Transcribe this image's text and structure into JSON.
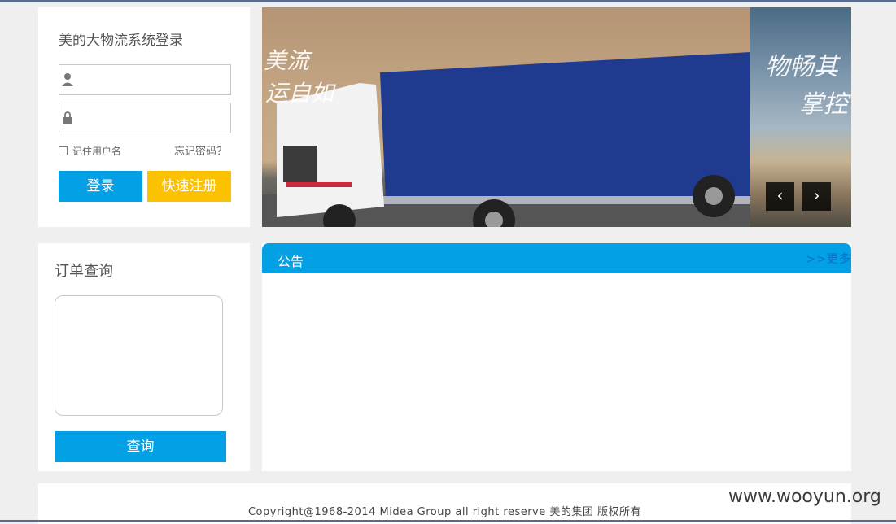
{
  "login": {
    "title": "美的大物流系统登录",
    "username_placeholder": "",
    "password_placeholder": "",
    "remember_label": "记住用户名",
    "forgot_label": "忘记密码？",
    "login_button": "登录",
    "register_button": "快速注册"
  },
  "banner": {
    "calligraphy_left_1": "美流",
    "calligraphy_left_2": "运自如",
    "calligraphy_right_1": "物畅其",
    "calligraphy_right_2": "掌控",
    "prev_label": "‹",
    "next_label": "›"
  },
  "order_query": {
    "title": "订单查询",
    "query_button": "查询"
  },
  "notice": {
    "title": "公告",
    "more_link": ">>更多"
  },
  "footer": {
    "copyright": "Copyright@1968-2014 Midea Group all right reserve  美的集团  版权所有"
  },
  "watermark": "www.wooyun.org",
  "colors": {
    "primary": "#03a0e6",
    "accent": "#fcc100",
    "background": "#efefef"
  }
}
